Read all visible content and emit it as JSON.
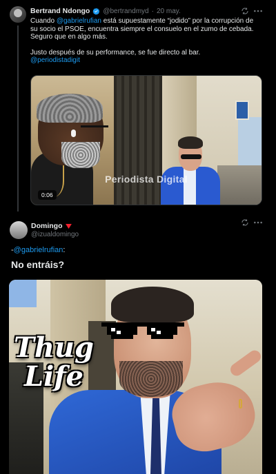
{
  "post1": {
    "author_name": "Bertrand Ndongo",
    "author_handle": "@bertrandmyd",
    "separator": "·",
    "date": "20 may.",
    "text_lines": [
      {
        "pre": "Cuando ",
        "mention": "@gabrielrufian",
        "post": " está supuestamente “jodido” por la corrupción de"
      },
      {
        "pre": "su socio el PSOE, encuentra siempre el consuelo en el zumo de cebada.",
        "mention": "",
        "post": ""
      },
      {
        "pre": "Seguro que en algo más.",
        "mention": "",
        "post": ""
      },
      {
        "pre": "Justo después de su performance, se fue directo al bar.",
        "mention": "",
        "post": ""
      }
    ],
    "tag_mention": "@periodistadigit",
    "video": {
      "watermark": "Periodista Digital",
      "duration": "0:06"
    }
  },
  "post2": {
    "author_name": "Domingo",
    "author_handle": "@izualdomingo",
    "reply_prefix": "-",
    "reply_mention": "@gabrielrufian",
    "reply_suffix": ":",
    "question": "No entráis?",
    "image_overlay": {
      "line1": "Thug",
      "line2": "Life"
    }
  },
  "icons": {
    "verified": "verified-badge-icon",
    "grok": "grok-icon",
    "more": "more-options-icon",
    "flag": "red-triangle-flag-icon"
  },
  "colors": {
    "background": "#000000",
    "text": "#e7e9ea",
    "secondary": "#71767b",
    "link": "#1d9bf0",
    "flag": "#f4212e"
  }
}
